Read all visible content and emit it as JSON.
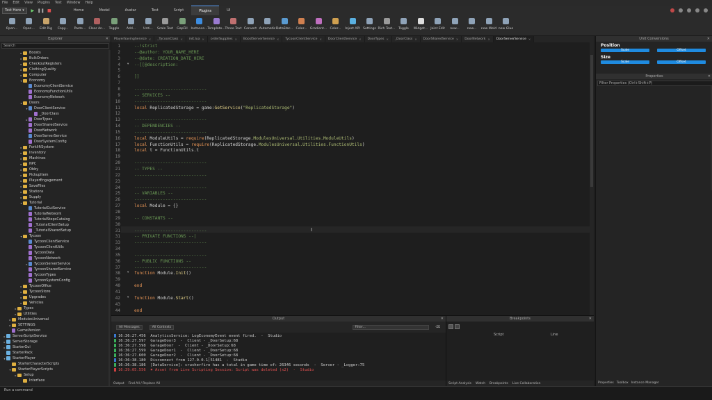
{
  "menu": [
    "File",
    "Edit",
    "View",
    "Plugins",
    "Test",
    "Window",
    "Help"
  ],
  "run_mode": "Test Here",
  "ribbon_tabs": [
    {
      "label": "Home",
      "active": false
    },
    {
      "label": "Model",
      "active": false
    },
    {
      "label": "Avatar",
      "active": false
    },
    {
      "label": "Test",
      "active": false
    },
    {
      "label": "Script",
      "active": false
    },
    {
      "label": "Plugins",
      "active": true
    },
    {
      "label": "UI",
      "active": false
    }
  ],
  "toolbar": [
    "Open...",
    "Open...",
    "Edit Rig",
    "Copy...",
    "Paste...",
    "Clear An...",
    "Toggle",
    "Add...",
    "Unti...",
    "Scale Text",
    "GapFill",
    "Instance...",
    "Template...",
    "Three Text",
    "Convert",
    "Automatic",
    "DataStor...",
    "Color...",
    "Gradient...",
    "Color...",
    "Inject API",
    "Settings",
    "Rich Text...",
    "Toggle",
    "Widget...",
    "Joint Edit",
    "new...",
    "new...",
    "new Weld",
    "new Glue"
  ],
  "explorer": {
    "title": "Explorer",
    "search_placeholder": "Search",
    "items": [
      {
        "label": "Boosts",
        "icon": "folder",
        "indent": 2,
        "arrow": "▸"
      },
      {
        "label": "BulkOrders",
        "icon": "folder",
        "indent": 2,
        "arrow": "▸"
      },
      {
        "label": "CheckoutRegisters",
        "icon": "folder",
        "indent": 2,
        "arrow": "▸"
      },
      {
        "label": "ClothingQuality",
        "icon": "folder",
        "indent": 2,
        "arrow": "▸"
      },
      {
        "label": "Computer",
        "icon": "folder",
        "indent": 2,
        "arrow": "▸"
      },
      {
        "label": "Economy",
        "icon": "folder",
        "indent": 2,
        "arrow": "▾"
      },
      {
        "label": "EconomyClientService",
        "icon": "script",
        "indent": 3,
        "arrow": ""
      },
      {
        "label": "EconomyFunctionUtils",
        "icon": "module",
        "indent": 3,
        "arrow": ""
      },
      {
        "label": "EconomyNetwork",
        "icon": "module",
        "indent": 3,
        "arrow": ""
      },
      {
        "label": "Doors",
        "icon": "folder",
        "indent": 2,
        "arrow": "▾"
      },
      {
        "label": "DoorClientService",
        "icon": "script",
        "indent": 3,
        "arrow": "▾"
      },
      {
        "label": "_DoorClass",
        "icon": "module",
        "indent": 4,
        "arrow": ""
      },
      {
        "label": "DoorTypes",
        "icon": "module",
        "indent": 3,
        "arrow": "▸"
      },
      {
        "label": "DoorSharedService",
        "icon": "module",
        "indent": 3,
        "arrow": ""
      },
      {
        "label": "DoorNetwork",
        "icon": "module",
        "indent": 3,
        "arrow": ""
      },
      {
        "label": "DoorServerService",
        "icon": "script",
        "indent": 3,
        "arrow": ""
      },
      {
        "label": "DoorSystemConfig",
        "icon": "module",
        "indent": 3,
        "arrow": ""
      },
      {
        "label": "ForkliftSystem",
        "icon": "folder",
        "indent": 2,
        "arrow": "▸"
      },
      {
        "label": "Inventory",
        "icon": "folder",
        "indent": 2,
        "arrow": "▸"
      },
      {
        "label": "Machines",
        "icon": "folder",
        "indent": 2,
        "arrow": "▸"
      },
      {
        "label": "NPC",
        "icon": "folder",
        "indent": 2,
        "arrow": "▸"
      },
      {
        "label": "Obby",
        "icon": "folder",
        "indent": 2,
        "arrow": "▸"
      },
      {
        "label": "PickupItem",
        "icon": "folder",
        "indent": 2,
        "arrow": "▸"
      },
      {
        "label": "PlayerEngagement",
        "icon": "folder",
        "indent": 2,
        "arrow": "▸"
      },
      {
        "label": "SaveFiles",
        "icon": "folder",
        "indent": 2,
        "arrow": "▸"
      },
      {
        "label": "Stations",
        "icon": "folder",
        "indent": 2,
        "arrow": "▸"
      },
      {
        "label": "Supply",
        "icon": "folder",
        "indent": 2,
        "arrow": "▸"
      },
      {
        "label": "Tutorial",
        "icon": "folder",
        "indent": 2,
        "arrow": "▾"
      },
      {
        "label": "TutorialGuiService",
        "icon": "script",
        "indent": 3,
        "arrow": ""
      },
      {
        "label": "TutorialNetwork",
        "icon": "module",
        "indent": 3,
        "arrow": ""
      },
      {
        "label": "TutorialStepsCatalog",
        "icon": "module",
        "indent": 3,
        "arrow": ""
      },
      {
        "label": "_TutorialClientSetup",
        "icon": "module",
        "indent": 3,
        "arrow": ""
      },
      {
        "label": "_TutorialSharedSetup",
        "icon": "module",
        "indent": 3,
        "arrow": ""
      },
      {
        "label": "Tycoon",
        "icon": "folder",
        "indent": 2,
        "arrow": "▾"
      },
      {
        "label": "TycoonClientService",
        "icon": "script",
        "indent": 3,
        "arrow": ""
      },
      {
        "label": "TycoonClientUtils",
        "icon": "module",
        "indent": 3,
        "arrow": ""
      },
      {
        "label": "TycoonData",
        "icon": "module",
        "indent": 3,
        "arrow": ""
      },
      {
        "label": "TycoonNetwork",
        "icon": "module",
        "indent": 3,
        "arrow": ""
      },
      {
        "label": "TycoonServerService",
        "icon": "script",
        "indent": 3,
        "arrow": "▸"
      },
      {
        "label": "TycoonSharedService",
        "icon": "module",
        "indent": 3,
        "arrow": ""
      },
      {
        "label": "TycoonTypes",
        "icon": "module",
        "indent": 3,
        "arrow": ""
      },
      {
        "label": "TycoonSystemConfig",
        "icon": "module",
        "indent": 3,
        "arrow": ""
      },
      {
        "label": "TycoonOffice",
        "icon": "folder",
        "indent": 2,
        "arrow": "▸"
      },
      {
        "label": "TycoonStore",
        "icon": "folder",
        "indent": 2,
        "arrow": "▸"
      },
      {
        "label": "Upgrades",
        "icon": "folder",
        "indent": 2,
        "arrow": "▸"
      },
      {
        "label": "Vehicles",
        "icon": "folder",
        "indent": 2,
        "arrow": "▸"
      },
      {
        "label": "Types",
        "icon": "folder",
        "indent": 1,
        "arrow": "▸"
      },
      {
        "label": "Utilities",
        "icon": "folder",
        "indent": 1,
        "arrow": "▸"
      },
      {
        "label": "ModulesUniversal",
        "icon": "folder",
        "indent": 0,
        "arrow": "▸"
      },
      {
        "label": "SETTINGS",
        "icon": "folder",
        "indent": 0,
        "arrow": "▸"
      },
      {
        "label": "GameVersion",
        "icon": "module",
        "indent": 0,
        "arrow": ""
      },
      {
        "label": "ServerScriptService",
        "icon": "service",
        "indent": -1,
        "arrow": "▸"
      },
      {
        "label": "ServerStorage",
        "icon": "service",
        "indent": -1,
        "arrow": "▸"
      },
      {
        "label": "StarterGui",
        "icon": "service",
        "indent": -1,
        "arrow": "▸"
      },
      {
        "label": "StarterPack",
        "icon": "service",
        "indent": -1,
        "arrow": ""
      },
      {
        "label": "StarterPlayer",
        "icon": "service",
        "indent": -1,
        "arrow": "▾"
      },
      {
        "label": "StarterCharacterScripts",
        "icon": "folder",
        "indent": 0,
        "arrow": ""
      },
      {
        "label": "StarterPlayerScripts",
        "icon": "folder",
        "indent": 0,
        "arrow": "▾"
      },
      {
        "label": "Setup",
        "icon": "folder",
        "indent": 1,
        "arrow": "▸"
      },
      {
        "label": "Interface",
        "icon": "folder",
        "indent": 2,
        "arrow": ""
      }
    ]
  },
  "doc_tabs": [
    {
      "label": "PlayerSavingService",
      "active": false
    },
    {
      "label": "_TycoonClass",
      "active": false
    },
    {
      "label": "init.lua",
      "active": false
    },
    {
      "label": "orderSupplies",
      "active": false
    },
    {
      "label": "BoostServerService",
      "active": false
    },
    {
      "label": "TycoonClientService",
      "active": false
    },
    {
      "label": "DoorClientService",
      "active": false
    },
    {
      "label": "DoorTypes",
      "active": false
    },
    {
      "label": "_DoorClass",
      "active": false
    },
    {
      "label": "DoorSharedService",
      "active": false
    },
    {
      "label": "DoorNetwork",
      "active": false
    },
    {
      "label": "DoorServerService",
      "active": true
    }
  ],
  "code_lines": [
    {
      "n": "1",
      "fold": false,
      "parts": [
        {
          "t": "--!strict",
          "c": "cm"
        }
      ]
    },
    {
      "n": "2",
      "fold": false,
      "parts": [
        {
          "t": "--@author: YOUR_NAME_HERE",
          "c": "cm"
        }
      ]
    },
    {
      "n": "3",
      "fold": false,
      "parts": [
        {
          "t": "--@date: CREATION_DATE_HERE",
          "c": "cm"
        }
      ]
    },
    {
      "n": "4",
      "fold": true,
      "parts": [
        {
          "t": "--[[@description:",
          "c": "cm"
        }
      ]
    },
    {
      "n": "5",
      "fold": false,
      "parts": [
        {
          "t": "",
          "c": ""
        }
      ]
    },
    {
      "n": "6",
      "fold": false,
      "parts": [
        {
          "t": "]]",
          "c": "cm"
        }
      ]
    },
    {
      "n": "7",
      "fold": false,
      "parts": [
        {
          "t": "",
          "c": ""
        }
      ]
    },
    {
      "n": "8",
      "fold": false,
      "parts": [
        {
          "t": "----------------------------",
          "c": "cm"
        }
      ]
    },
    {
      "n": "9",
      "fold": false,
      "parts": [
        {
          "t": "-- SERVICES --",
          "c": "cm"
        }
      ]
    },
    {
      "n": "10",
      "fold": false,
      "parts": [
        {
          "t": "----------------------------",
          "c": "cm"
        }
      ]
    },
    {
      "n": "11",
      "fold": false,
      "parts": [
        {
          "t": "local ",
          "c": "kw"
        },
        {
          "t": "ReplicatedStorage = game:",
          "c": ""
        },
        {
          "t": "GetService",
          "c": "fn"
        },
        {
          "t": "(",
          "c": ""
        },
        {
          "t": "\"ReplicatedStorage\"",
          "c": "st"
        },
        {
          "t": ")",
          "c": ""
        }
      ]
    },
    {
      "n": "12",
      "fold": false,
      "parts": [
        {
          "t": "",
          "c": ""
        }
      ]
    },
    {
      "n": "13",
      "fold": false,
      "parts": [
        {
          "t": "----------------------------",
          "c": "cm"
        }
      ]
    },
    {
      "n": "14",
      "fold": false,
      "parts": [
        {
          "t": "-- DEPENDENCIES --",
          "c": "cm"
        }
      ]
    },
    {
      "n": "15",
      "fold": false,
      "parts": [
        {
          "t": "----------------------------",
          "c": "cm"
        }
      ]
    },
    {
      "n": "16",
      "fold": false,
      "parts": [
        {
          "t": "local ",
          "c": "kw"
        },
        {
          "t": "ModuleUtils = ",
          "c": ""
        },
        {
          "t": "require",
          "c": "kw"
        },
        {
          "t": "(ReplicatedStorage.",
          "c": ""
        },
        {
          "t": "ModulesUniversal.Utilities.ModuleUtils",
          "c": "st"
        },
        {
          "t": ")",
          "c": ""
        }
      ]
    },
    {
      "n": "17",
      "fold": false,
      "parts": [
        {
          "t": "local ",
          "c": "kw"
        },
        {
          "t": "FunctionUtils = ",
          "c": ""
        },
        {
          "t": "require",
          "c": "kw"
        },
        {
          "t": "(ReplicatedStorage.",
          "c": ""
        },
        {
          "t": "ModulesUniversal.Utilities.FunctionUtils",
          "c": "st"
        },
        {
          "t": ")",
          "c": ""
        }
      ]
    },
    {
      "n": "18",
      "fold": false,
      "parts": [
        {
          "t": "local ",
          "c": "kw"
        },
        {
          "t": "t = FunctionUtils.t",
          "c": ""
        }
      ]
    },
    {
      "n": "19",
      "fold": false,
      "parts": [
        {
          "t": "",
          "c": ""
        }
      ]
    },
    {
      "n": "20",
      "fold": false,
      "parts": [
        {
          "t": "----------------------------",
          "c": "cm"
        }
      ]
    },
    {
      "n": "21",
      "fold": false,
      "parts": [
        {
          "t": "-- TYPES --",
          "c": "cm"
        }
      ]
    },
    {
      "n": "22",
      "fold": false,
      "parts": [
        {
          "t": "----------------------------",
          "c": "cm"
        }
      ]
    },
    {
      "n": "23",
      "fold": false,
      "parts": [
        {
          "t": "",
          "c": ""
        }
      ]
    },
    {
      "n": "24",
      "fold": false,
      "parts": [
        {
          "t": "----------------------------",
          "c": "cm"
        }
      ]
    },
    {
      "n": "25",
      "fold": false,
      "parts": [
        {
          "t": "-- VARIABLES --",
          "c": "cm"
        }
      ]
    },
    {
      "n": "26",
      "fold": false,
      "parts": [
        {
          "t": "----------------------------",
          "c": "cm"
        }
      ]
    },
    {
      "n": "27",
      "fold": false,
      "parts": [
        {
          "t": "local ",
          "c": "kw"
        },
        {
          "t": "Module = {}",
          "c": ""
        }
      ]
    },
    {
      "n": "28",
      "fold": false,
      "parts": [
        {
          "t": "",
          "c": ""
        }
      ]
    },
    {
      "n": "29",
      "fold": false,
      "parts": [
        {
          "t": "-- CONSTANTS --",
          "c": "cm"
        }
      ]
    },
    {
      "n": "30",
      "fold": false,
      "parts": [
        {
          "t": "",
          "c": ""
        }
      ]
    },
    {
      "n": "31",
      "fold": false,
      "parts": [
        {
          "t": "----------------------------",
          "c": "cm"
        }
      ]
    },
    {
      "n": "31",
      "fold": false,
      "parts": [
        {
          "t": "-- PRIVATE FUNCTIONS --|",
          "c": "cm"
        }
      ]
    },
    {
      "n": "33",
      "fold": false,
      "parts": [
        {
          "t": "----------------------------",
          "c": "cm"
        }
      ]
    },
    {
      "n": "34",
      "fold": false,
      "parts": [
        {
          "t": "",
          "c": ""
        }
      ]
    },
    {
      "n": "35",
      "fold": false,
      "parts": [
        {
          "t": "----------------------------",
          "c": "cm"
        }
      ]
    },
    {
      "n": "36",
      "fold": false,
      "parts": [
        {
          "t": "-- PUBLIC FUNCTIONS --",
          "c": "cm"
        }
      ]
    },
    {
      "n": "37",
      "fold": false,
      "parts": [
        {
          "t": "----------------------------",
          "c": "cm"
        }
      ]
    },
    {
      "n": "38",
      "fold": true,
      "parts": [
        {
          "t": "function ",
          "c": "kw"
        },
        {
          "t": "Module.",
          "c": ""
        },
        {
          "t": "Init",
          "c": "fn"
        },
        {
          "t": "()",
          "c": ""
        }
      ]
    },
    {
      "n": "39",
      "fold": false,
      "parts": [
        {
          "t": "",
          "c": ""
        }
      ]
    },
    {
      "n": "40",
      "fold": false,
      "parts": [
        {
          "t": "end",
          "c": "kw"
        }
      ]
    },
    {
      "n": "41",
      "fold": false,
      "parts": [
        {
          "t": "",
          "c": ""
        }
      ]
    },
    {
      "n": "42",
      "fold": true,
      "parts": [
        {
          "t": "function ",
          "c": "kw"
        },
        {
          "t": "Module.",
          "c": ""
        },
        {
          "t": "Start",
          "c": "fn"
        },
        {
          "t": "()",
          "c": ""
        }
      ]
    },
    {
      "n": "43",
      "fold": false,
      "parts": [
        {
          "t": "",
          "c": ""
        }
      ]
    },
    {
      "n": "44",
      "fold": false,
      "parts": [
        {
          "t": "end",
          "c": "kw"
        }
      ]
    }
  ],
  "output": {
    "title": "Output",
    "filter_messages": "All Messages",
    "filter_contexts": "All Contexts",
    "filter_placeholder": "Filter...",
    "lines": [
      {
        "text": "16:36:27.456  AnalyticsService: LogEconomyEvent event fired.  -  Studio",
        "kind": "blue"
      },
      {
        "text": "16:36:27.597  GarageDoor3  -  Client - _DoorSetup:68",
        "kind": "green"
      },
      {
        "text": "16:36:27.598  GarageDoor  -  Client - _DoorSetup:68",
        "kind": "green"
      },
      {
        "text": "16:36:27.599  GarageDoor1  -  Client - _DoorSetup:68",
        "kind": "green"
      },
      {
        "text": "16:36:27.600  GarageDoor2  -  Client - _DoorSetup:68",
        "kind": "green"
      },
      {
        "text": "16:36:38.180  Disconnect from 127.0.0.1|51481  -  Studio",
        "kind": "blue"
      },
      {
        "text": "16:36:38.186  [DataService]: crusherfire has a total in game time of: 26346 seconds  -  Server - _Logger:75",
        "kind": "green"
      },
      {
        "text": "16:39:05.556  ✖ Asset from Live Scripting Session: Script was deleted (x2)  -  Studio",
        "kind": "red"
      }
    ],
    "bottom_tabs": [
      "Output",
      "Find All / Replace All"
    ]
  },
  "breakpoints": {
    "title": "Breakpoints",
    "columns": [
      "Script",
      "Line"
    ],
    "bottom_tabs": [
      "Script Analysis",
      "Watch",
      "Breakpoints",
      "Live Collaboration"
    ]
  },
  "unit_conversions": {
    "title": "Unit Conversions",
    "position_label": "Position",
    "size_label": "Size",
    "scale_label": "Scale",
    "offset_label": "Offset"
  },
  "properties": {
    "title": "Properties",
    "filter_placeholder": "Filter Properties (Ctrl+Shift+P)",
    "bottom_tabs": [
      "Properties",
      "Toolbox",
      "Instance Manager"
    ]
  },
  "command_bar": {
    "placeholder": "Run a command"
  },
  "colors": {
    "accent": "#1f8be0",
    "comment": "#6a9955",
    "keyword": "#e89556",
    "string": "#adbc74",
    "error": "#e05050"
  }
}
